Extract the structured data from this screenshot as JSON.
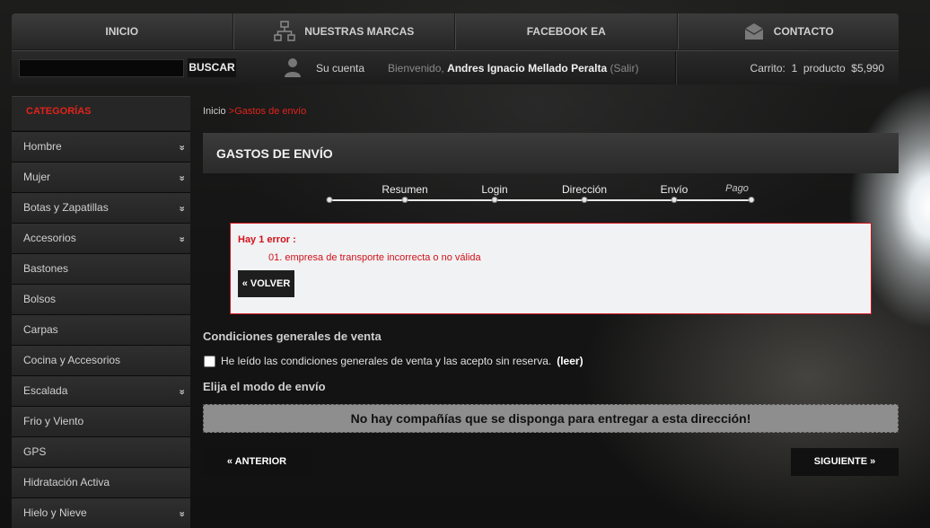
{
  "nav": {
    "inicio": "INICIO",
    "marcas": "NUESTRAS MARCAS",
    "facebook": "FACEBOOK EA",
    "contacto": "CONTACTO"
  },
  "topbar": {
    "search_value": "",
    "search_button": "BUSCAR",
    "account": "Su cuenta",
    "welcome": "Bienvenido,",
    "user_name": "Andres Ignacio Mellado Peralta",
    "logout": "(Salir)",
    "cart_label": "Carrito:",
    "cart_count": "1",
    "cart_unit": "producto",
    "cart_total": "$5,990"
  },
  "sidebar": {
    "title": "CATEGORÍAS",
    "items": [
      {
        "label": "Hombre",
        "chevron": "»"
      },
      {
        "label": "Mujer",
        "chevron": "»"
      },
      {
        "label": "Botas y Zapatillas",
        "chevron": "»"
      },
      {
        "label": "Accesorios",
        "chevron": "»"
      },
      {
        "label": "Bastones",
        "chevron": ""
      },
      {
        "label": "Bolsos",
        "chevron": ""
      },
      {
        "label": "Carpas",
        "chevron": ""
      },
      {
        "label": "Cocina y Accesorios",
        "chevron": ""
      },
      {
        "label": "Escalada",
        "chevron": "»"
      },
      {
        "label": "Frio y Viento",
        "chevron": ""
      },
      {
        "label": "GPS",
        "chevron": ""
      },
      {
        "label": "Hidratación Activa",
        "chevron": ""
      },
      {
        "label": "Hielo y Nieve",
        "chevron": "»"
      }
    ]
  },
  "breadcrumb": {
    "home": "Inicio",
    "separator": ">",
    "current": "Gastos de envío"
  },
  "page": {
    "title": "GASTOS DE ENVÍO"
  },
  "steps": [
    "Resumen",
    "Login",
    "Dirección",
    "Envío",
    "Pago"
  ],
  "error": {
    "title": "Hay 1 error :",
    "item": "01. empresa de transporte incorrecta o no válida",
    "back_button": "« VOLVER"
  },
  "conditions": {
    "title": "Condiciones generales de venta",
    "checkbox_label": "He leído las condiciones generales de venta y las acepto sin reserva.",
    "read_link": "(leer)"
  },
  "shipping": {
    "title": "Elija el modo de envío",
    "message": "No hay compañías que se disponga para entregar a esta dirección!"
  },
  "buttons": {
    "previous": "« ANTERIOR",
    "next": "SIGUIENTE »"
  },
  "colors": {
    "accent_red": "#e2231a",
    "error_red": "#d0121c"
  }
}
